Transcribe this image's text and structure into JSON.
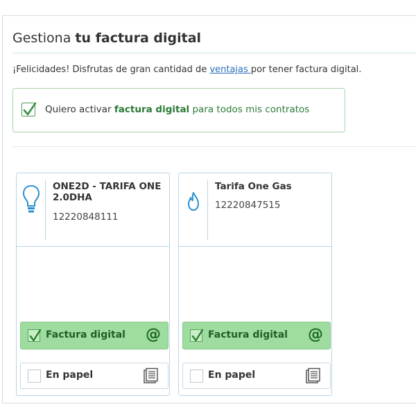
{
  "header": {
    "title_light": "Gestiona ",
    "title_bold": "tu factura digital"
  },
  "intro": {
    "text_before": "¡Felicidades! Disfrutas de gran cantidad de ",
    "link_text": "ventajas ",
    "text_after": "por tener factura digital."
  },
  "activate": {
    "checked": true,
    "label_before": "Quiero activar ",
    "label_bold": "factura digital",
    "label_after": " para todos mis contratos"
  },
  "contracts": [
    {
      "icon": "lightbulb-icon",
      "name": "ONE2D - TARIFA ONE 2.0DHA",
      "number": "12220848111",
      "digital_label": "Factura digital",
      "digital_checked": true,
      "paper_label": "En papel",
      "paper_checked": false
    },
    {
      "icon": "gas-flame-icon",
      "name": "Tarifa One Gas",
      "number": "12220847515",
      "digital_label": "Factura digital",
      "digital_checked": true,
      "paper_label": "En papel",
      "paper_checked": false
    }
  ],
  "colors": {
    "accent_green": "#2b7a36",
    "selected_bg": "#9fdc9f",
    "icon_blue": "#2a8fd0",
    "link_blue": "#2a6ebb"
  }
}
